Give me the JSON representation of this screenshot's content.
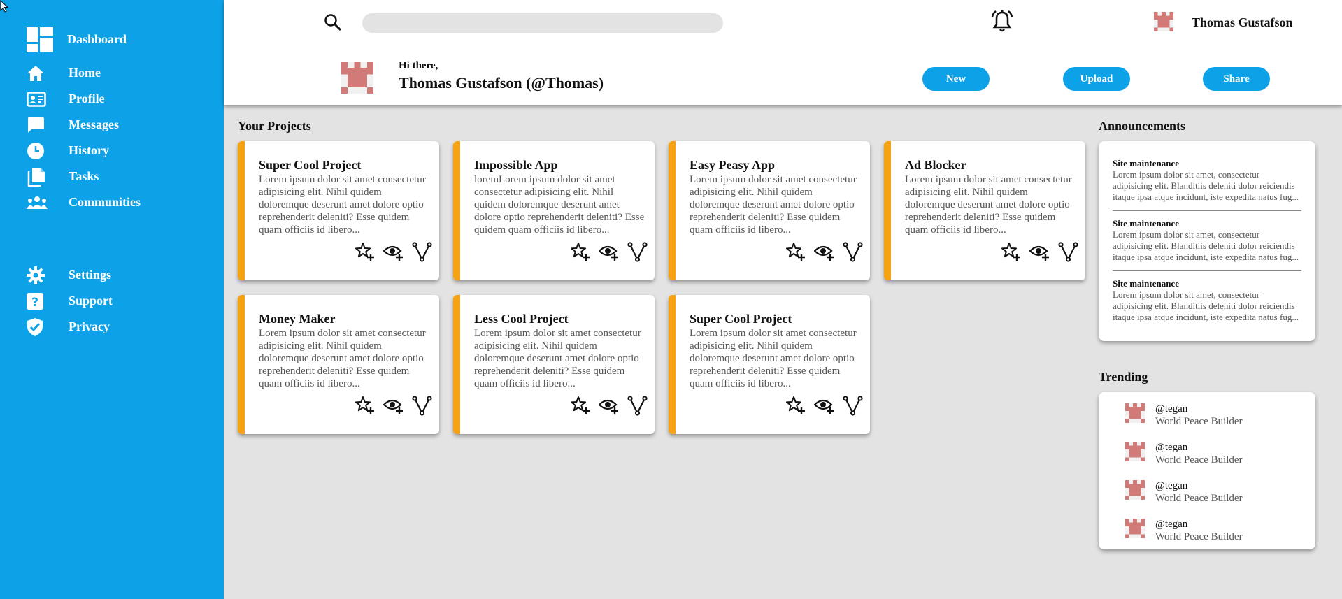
{
  "sidebar": {
    "brand": "Dashboard",
    "nav": [
      {
        "label": "Home",
        "icon": "home-icon"
      },
      {
        "label": "Profile",
        "icon": "profile-card-icon"
      },
      {
        "label": "Messages",
        "icon": "chat-bubble-icon"
      },
      {
        "label": "History",
        "icon": "clock-icon"
      },
      {
        "label": "Tasks",
        "icon": "documents-icon"
      },
      {
        "label": "Communities",
        "icon": "people-group-icon"
      }
    ],
    "bottom": [
      {
        "label": "Settings",
        "icon": "gear-icon"
      },
      {
        "label": "Support",
        "icon": "help-icon"
      },
      {
        "label": "Privacy",
        "icon": "shield-check-icon"
      }
    ]
  },
  "header": {
    "search_placeholder": "",
    "user_name": "Thomas Gustafson",
    "greeting_small": "Hi there,",
    "greeting_name": "Thomas Gustafson (@Thomas)",
    "buttons": {
      "new": "New",
      "upload": "Upload",
      "share": "Share"
    }
  },
  "projects": {
    "title": "Your Projects",
    "items": [
      {
        "title": "Super Cool Project",
        "desc": "Lorem ipsum dolor sit amet consectetur adipisicing elit. Nihil quidem doloremque deserunt amet dolore optio reprehenderit deleniti? Esse quidem quam officiis id libero..."
      },
      {
        "title": "Impossible App",
        "desc": "loremLorem ipsum dolor sit amet consectetur adipisicing elit. Nihil quidem doloremque deserunt amet dolore optio reprehenderit deleniti? Esse quidem quam officiis id libero..."
      },
      {
        "title": "Easy Peasy App",
        "desc": "Lorem ipsum dolor sit amet consectetur adipisicing elit. Nihil quidem doloremque deserunt amet dolore optio reprehenderit deleniti? Esse quidem quam officiis id libero..."
      },
      {
        "title": "Ad Blocker",
        "desc": "Lorem ipsum dolor sit amet consectetur adipisicing elit. Nihil quidem doloremque deserunt amet dolore optio reprehenderit deleniti? Esse quidem quam officiis id libero..."
      },
      {
        "title": "Money Maker",
        "desc": "Lorem ipsum dolor sit amet consectetur adipisicing elit. Nihil quidem doloremque deserunt amet dolore optio reprehenderit deleniti? Esse quidem quam officiis id libero..."
      },
      {
        "title": "Less Cool Project",
        "desc": "Lorem ipsum dolor sit amet consectetur adipisicing elit. Nihil quidem doloremque deserunt amet dolore optio reprehenderit deleniti? Esse quidem quam officiis id libero..."
      },
      {
        "title": "Super Cool Project",
        "desc": "Lorem ipsum dolor sit amet consectetur adipisicing elit. Nihil quidem doloremque deserunt amet dolore optio reprehenderit deleniti? Esse quidem quam officiis id libero..."
      }
    ]
  },
  "announcements": {
    "title": "Announcements",
    "items": [
      {
        "title": "Site maintenance",
        "desc": "Lorem ipsum dolor sit amet, consectetur adipisicing elit. Blanditiis deleniti dolor reiciendis itaque ipsa atque incidunt, iste expedita natus fug..."
      },
      {
        "title": "Site maintenance",
        "desc": "Lorem ipsum dolor sit amet, consectetur adipisicing elit. Blanditiis deleniti dolor reiciendis itaque ipsa atque incidunt, iste expedita natus fug..."
      },
      {
        "title": "Site maintenance",
        "desc": "Lorem ipsum dolor sit amet, consectetur adipisicing elit. Blanditiis deleniti dolor reiciendis itaque ipsa atque incidunt, iste expedita natus fug..."
      }
    ]
  },
  "trending": {
    "title": "Trending",
    "items": [
      {
        "handle": "@tegan",
        "subtitle": "World Peace Builder"
      },
      {
        "handle": "@tegan",
        "subtitle": "World Peace Builder"
      },
      {
        "handle": "@tegan",
        "subtitle": "World Peace Builder"
      },
      {
        "handle": "@tegan",
        "subtitle": "World Peace Builder"
      }
    ]
  },
  "colors": {
    "sidebar": "#0da2e7",
    "accent": "#f5a313",
    "button": "#0da2e7",
    "background": "#e3e3e3"
  }
}
